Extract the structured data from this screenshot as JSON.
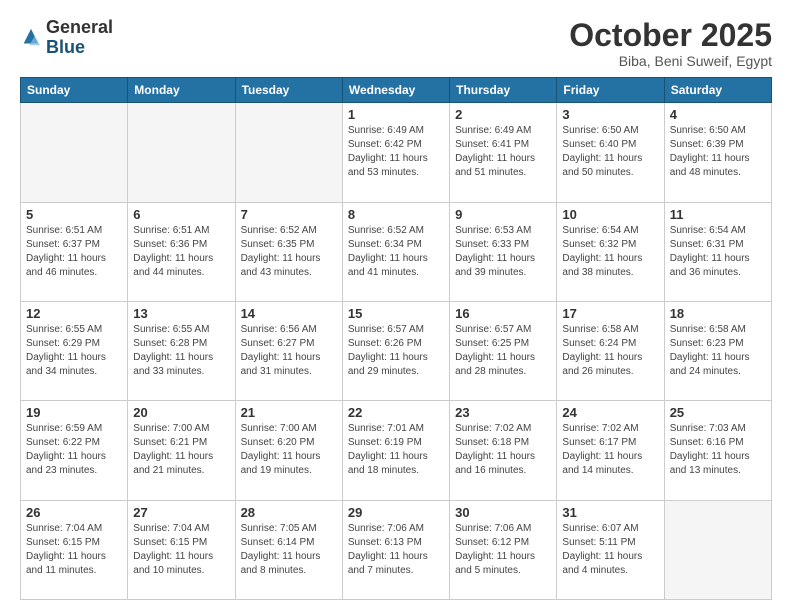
{
  "header": {
    "logo_general": "General",
    "logo_blue": "Blue",
    "month_title": "October 2025",
    "location": "Biba, Beni Suweif, Egypt"
  },
  "days_of_week": [
    "Sunday",
    "Monday",
    "Tuesday",
    "Wednesday",
    "Thursday",
    "Friday",
    "Saturday"
  ],
  "weeks": [
    [
      {
        "day": "",
        "info": "",
        "empty": true
      },
      {
        "day": "",
        "info": "",
        "empty": true
      },
      {
        "day": "",
        "info": "",
        "empty": true
      },
      {
        "day": "1",
        "info": "Sunrise: 6:49 AM\nSunset: 6:42 PM\nDaylight: 11 hours\nand 53 minutes."
      },
      {
        "day": "2",
        "info": "Sunrise: 6:49 AM\nSunset: 6:41 PM\nDaylight: 11 hours\nand 51 minutes."
      },
      {
        "day": "3",
        "info": "Sunrise: 6:50 AM\nSunset: 6:40 PM\nDaylight: 11 hours\nand 50 minutes."
      },
      {
        "day": "4",
        "info": "Sunrise: 6:50 AM\nSunset: 6:39 PM\nDaylight: 11 hours\nand 48 minutes."
      }
    ],
    [
      {
        "day": "5",
        "info": "Sunrise: 6:51 AM\nSunset: 6:37 PM\nDaylight: 11 hours\nand 46 minutes."
      },
      {
        "day": "6",
        "info": "Sunrise: 6:51 AM\nSunset: 6:36 PM\nDaylight: 11 hours\nand 44 minutes."
      },
      {
        "day": "7",
        "info": "Sunrise: 6:52 AM\nSunset: 6:35 PM\nDaylight: 11 hours\nand 43 minutes."
      },
      {
        "day": "8",
        "info": "Sunrise: 6:52 AM\nSunset: 6:34 PM\nDaylight: 11 hours\nand 41 minutes."
      },
      {
        "day": "9",
        "info": "Sunrise: 6:53 AM\nSunset: 6:33 PM\nDaylight: 11 hours\nand 39 minutes."
      },
      {
        "day": "10",
        "info": "Sunrise: 6:54 AM\nSunset: 6:32 PM\nDaylight: 11 hours\nand 38 minutes."
      },
      {
        "day": "11",
        "info": "Sunrise: 6:54 AM\nSunset: 6:31 PM\nDaylight: 11 hours\nand 36 minutes."
      }
    ],
    [
      {
        "day": "12",
        "info": "Sunrise: 6:55 AM\nSunset: 6:29 PM\nDaylight: 11 hours\nand 34 minutes."
      },
      {
        "day": "13",
        "info": "Sunrise: 6:55 AM\nSunset: 6:28 PM\nDaylight: 11 hours\nand 33 minutes."
      },
      {
        "day": "14",
        "info": "Sunrise: 6:56 AM\nSunset: 6:27 PM\nDaylight: 11 hours\nand 31 minutes."
      },
      {
        "day": "15",
        "info": "Sunrise: 6:57 AM\nSunset: 6:26 PM\nDaylight: 11 hours\nand 29 minutes."
      },
      {
        "day": "16",
        "info": "Sunrise: 6:57 AM\nSunset: 6:25 PM\nDaylight: 11 hours\nand 28 minutes."
      },
      {
        "day": "17",
        "info": "Sunrise: 6:58 AM\nSunset: 6:24 PM\nDaylight: 11 hours\nand 26 minutes."
      },
      {
        "day": "18",
        "info": "Sunrise: 6:58 AM\nSunset: 6:23 PM\nDaylight: 11 hours\nand 24 minutes."
      }
    ],
    [
      {
        "day": "19",
        "info": "Sunrise: 6:59 AM\nSunset: 6:22 PM\nDaylight: 11 hours\nand 23 minutes."
      },
      {
        "day": "20",
        "info": "Sunrise: 7:00 AM\nSunset: 6:21 PM\nDaylight: 11 hours\nand 21 minutes."
      },
      {
        "day": "21",
        "info": "Sunrise: 7:00 AM\nSunset: 6:20 PM\nDaylight: 11 hours\nand 19 minutes."
      },
      {
        "day": "22",
        "info": "Sunrise: 7:01 AM\nSunset: 6:19 PM\nDaylight: 11 hours\nand 18 minutes."
      },
      {
        "day": "23",
        "info": "Sunrise: 7:02 AM\nSunset: 6:18 PM\nDaylight: 11 hours\nand 16 minutes."
      },
      {
        "day": "24",
        "info": "Sunrise: 7:02 AM\nSunset: 6:17 PM\nDaylight: 11 hours\nand 14 minutes."
      },
      {
        "day": "25",
        "info": "Sunrise: 7:03 AM\nSunset: 6:16 PM\nDaylight: 11 hours\nand 13 minutes."
      }
    ],
    [
      {
        "day": "26",
        "info": "Sunrise: 7:04 AM\nSunset: 6:15 PM\nDaylight: 11 hours\nand 11 minutes."
      },
      {
        "day": "27",
        "info": "Sunrise: 7:04 AM\nSunset: 6:15 PM\nDaylight: 11 hours\nand 10 minutes."
      },
      {
        "day": "28",
        "info": "Sunrise: 7:05 AM\nSunset: 6:14 PM\nDaylight: 11 hours\nand 8 minutes."
      },
      {
        "day": "29",
        "info": "Sunrise: 7:06 AM\nSunset: 6:13 PM\nDaylight: 11 hours\nand 7 minutes."
      },
      {
        "day": "30",
        "info": "Sunrise: 7:06 AM\nSunset: 6:12 PM\nDaylight: 11 hours\nand 5 minutes."
      },
      {
        "day": "31",
        "info": "Sunrise: 6:07 AM\nSunset: 5:11 PM\nDaylight: 11 hours\nand 4 minutes."
      },
      {
        "day": "",
        "info": "",
        "empty": true
      }
    ]
  ]
}
